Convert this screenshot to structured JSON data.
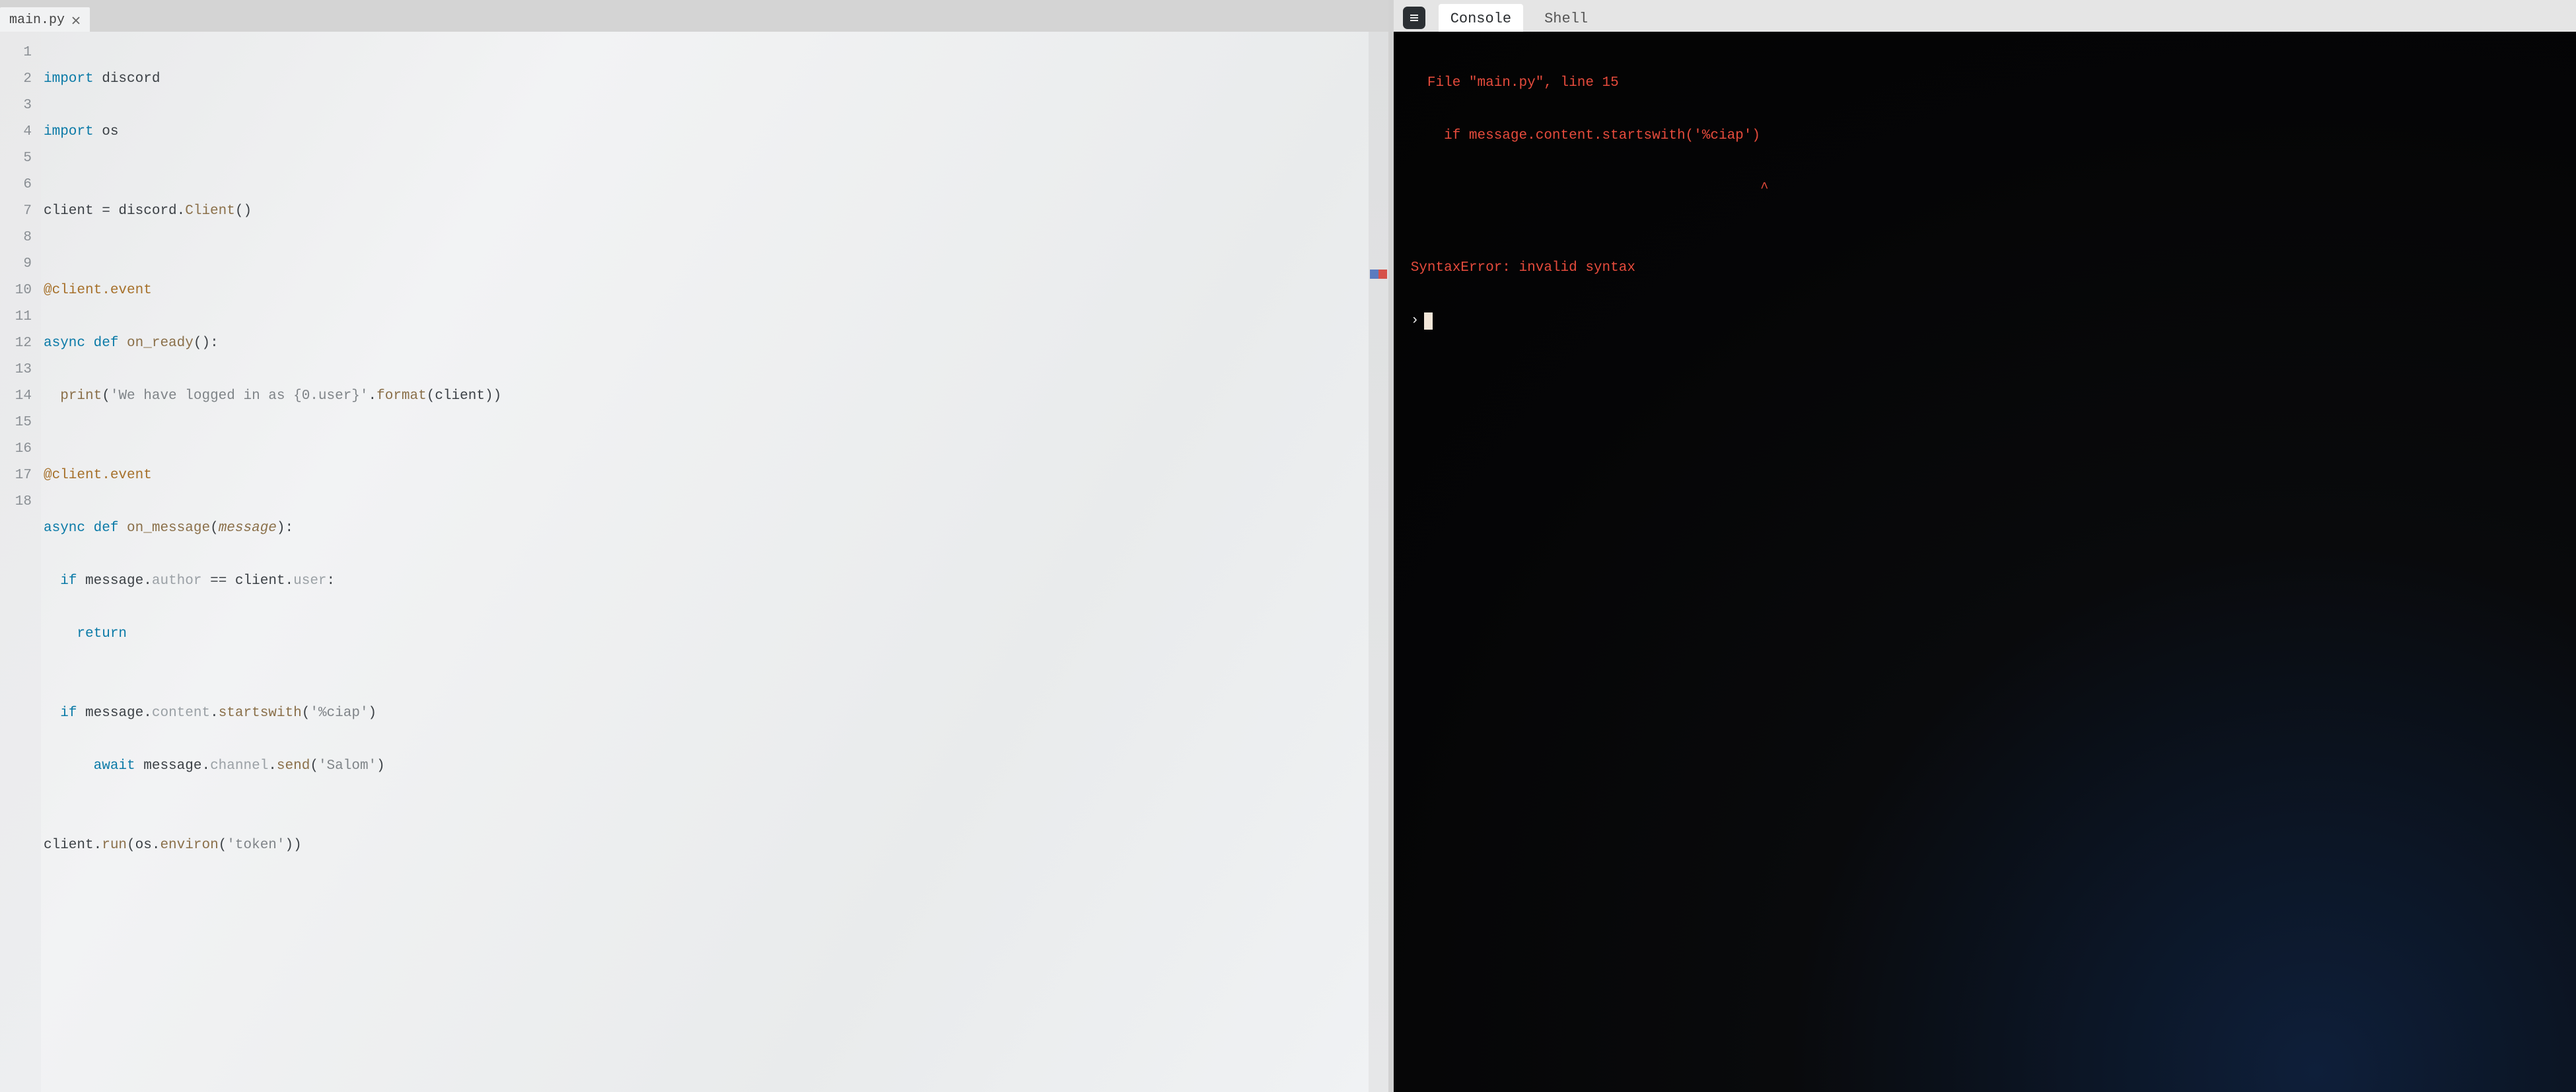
{
  "editor": {
    "tab": {
      "filename": "main.py",
      "close_tooltip": "Close"
    },
    "line_numbers": [
      "1",
      "2",
      "3",
      "4",
      "5",
      "6",
      "7",
      "8",
      "9",
      "10",
      "11",
      "12",
      "13",
      "14",
      "15",
      "16",
      "17",
      "18"
    ],
    "code": {
      "l1": {
        "kw": "import",
        "rest": " discord"
      },
      "l2": {
        "kw": "import",
        "rest": " os"
      },
      "l3": "",
      "l4": {
        "a": "client ",
        "op": "=",
        "b": " discord.",
        "fn": "Client",
        "rest": "()"
      },
      "l5": "",
      "l6": "@client.event",
      "l7": {
        "kw1": "async ",
        "kw2": "def ",
        "fn": "on_ready",
        "rest": "():"
      },
      "l8": {
        "indent": "  ",
        "fn": "print",
        "p1": "(",
        "str": "'We have logged in as {0.user}'",
        "dot": ".",
        "fn2": "format",
        "p2": "(client))"
      },
      "l9": "",
      "l10": "@client.event",
      "l11": {
        "kw1": "async ",
        "kw2": "def ",
        "fn": "on_message",
        "p1": "(",
        "par": "message",
        "p2": "):"
      },
      "l12": {
        "indent": "  ",
        "kw": "if ",
        "a": "message.",
        "attr": "author",
        "op": " == ",
        "b": "client.",
        "attr2": "user",
        "end": ":"
      },
      "l13": {
        "indent": "    ",
        "kw": "return"
      },
      "l14": "",
      "l15": {
        "indent": "  ",
        "kw": "if ",
        "a": "message.",
        "attr": "content",
        "dot": ".",
        "fn": "startswith",
        "p1": "(",
        "str": "'%ciap'",
        "p2": ")"
      },
      "l16": {
        "indent": "      ",
        "kw": "await ",
        "a": "message.",
        "attr": "channel",
        "dot": ".",
        "fn": "send",
        "p1": "(",
        "str": "'Salom'",
        "p2": ")"
      },
      "l17": "",
      "l18": {
        "a": "client.",
        "fn": "run",
        "p1": "(os.",
        "fn2": "environ",
        "p2": "(",
        "str": "'token'",
        "p3": "))"
      }
    }
  },
  "console": {
    "badge_icon_name": "list-icon",
    "tabs": {
      "console": "Console",
      "shell": "Shell",
      "active": "console"
    },
    "output": {
      "line1": "  File \"main.py\", line 15",
      "line2": "    if message.content.startswith('%ciap')",
      "caret": "                                          ^",
      "blank": "",
      "line3": "SyntaxError: invalid syntax",
      "prompt": "›"
    }
  }
}
